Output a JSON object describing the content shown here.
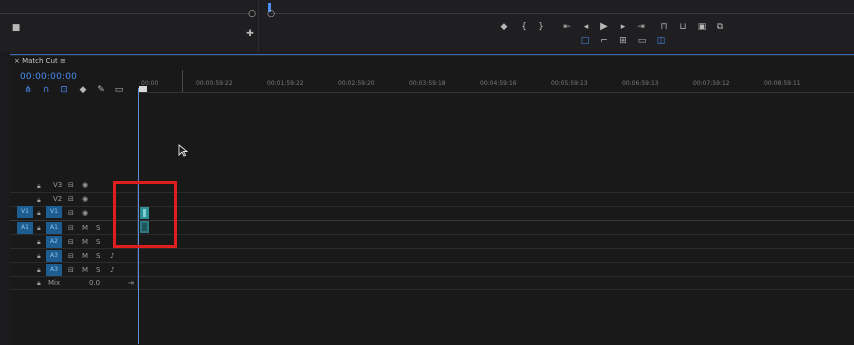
{
  "app": {
    "sequence_tab": "Match Cut",
    "timecode": "00:00:00:00"
  },
  "ruler": {
    "labels": [
      "00:00",
      "00:00:59:22",
      "00:01:59:22",
      "00:02:59:20",
      "00:03:59:18",
      "00:04:59:16",
      "00:05:59:13",
      "00:06:59:13",
      "00:07:59:12",
      "00:08:59:11"
    ]
  },
  "tracks": {
    "video": [
      "V3",
      "V2",
      "V1"
    ],
    "audio": [
      "A1",
      "A2",
      "A3"
    ],
    "mix_label": "Mix",
    "mix_value": "0.0",
    "source_v": "V1",
    "source_a": "A1"
  },
  "toolbar_icons": [
    "snap-icon",
    "linked-selection-icon",
    "markers-icon",
    "wrench-icon",
    "captions-icon"
  ],
  "program_controls": [
    "marker-icon",
    "in-point-icon",
    "out-point-icon",
    "go-to-in-icon",
    "step-back-icon",
    "play-icon",
    "step-forward-icon",
    "go-to-out-icon",
    "insert-icon",
    "overwrite-icon",
    "export-frame-icon",
    "compare-icon"
  ],
  "colors": {
    "accent": "#4a8cf0",
    "track_target": "#1e5d8f",
    "clip": "#2e8f96",
    "highlight": "#e01e1e"
  }
}
